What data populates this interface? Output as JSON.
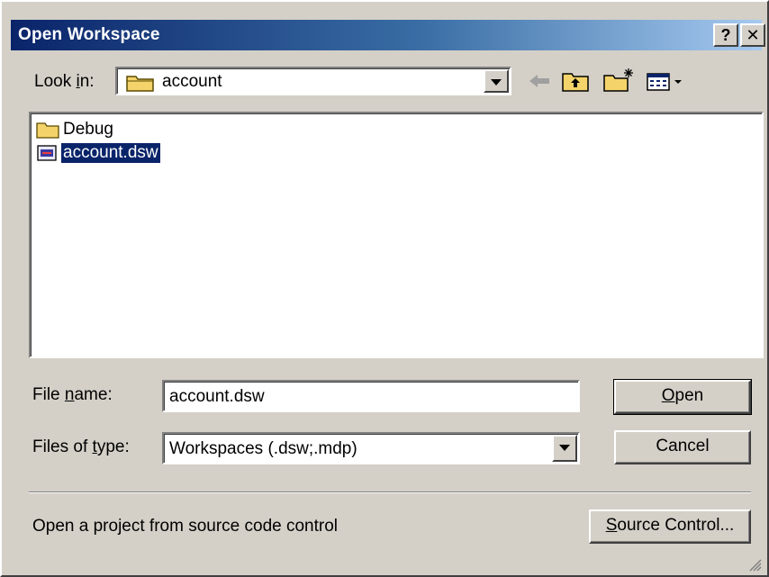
{
  "window": {
    "title": "Open Workspace"
  },
  "titlebar": {
    "help_label": "?",
    "close_label": "✕"
  },
  "look_in": {
    "label_pre": "Look ",
    "label_key": "i",
    "label_post": "n:",
    "value": "account",
    "icon": "folder-open-icon"
  },
  "toolbar": {
    "icons": [
      "back-arrow-icon",
      "up-one-level-icon",
      "create-new-folder-icon",
      "view-menu-icon"
    ]
  },
  "file_list": {
    "items": [
      {
        "name": "Debug",
        "icon": "folder-icon",
        "selected": false
      },
      {
        "name": "account.dsw",
        "icon": "workspace-file-icon",
        "selected": true
      }
    ]
  },
  "file_name": {
    "label_pre": "File ",
    "label_key": "n",
    "label_post": "ame:",
    "value": "account.dsw"
  },
  "file_type": {
    "label_pre": "Files of ",
    "label_key": "t",
    "label_post": "ype:",
    "value": "Workspaces (.dsw;.mdp)"
  },
  "buttons": {
    "open_key": "O",
    "open_rest": "pen",
    "cancel": "Cancel",
    "source_key": "S",
    "source_rest": "ource Control..."
  },
  "source_control_text": "Open a project from source code control",
  "colors": {
    "titlebar_start": "#0a246a",
    "titlebar_end": "#a6caf0",
    "selection": "#0a246a",
    "face": "#d4d0c8"
  }
}
